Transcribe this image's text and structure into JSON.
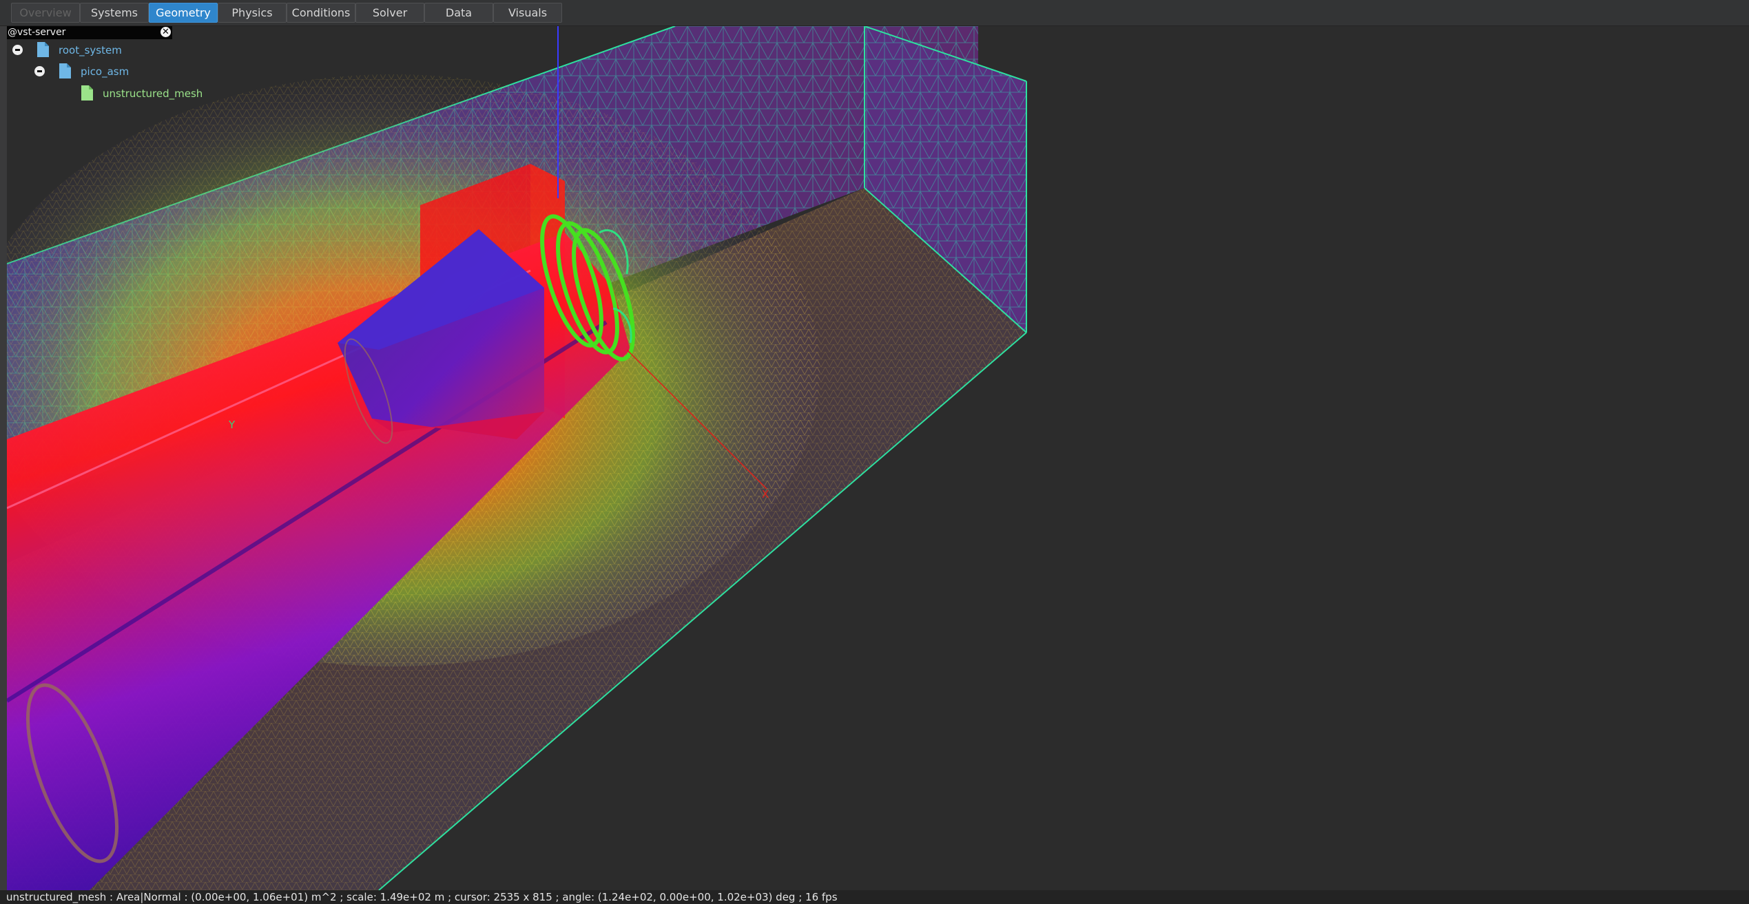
{
  "tabs": [
    {
      "label": "Overview",
      "state": "disabled"
    },
    {
      "label": "Systems",
      "state": "normal"
    },
    {
      "label": "Geometry",
      "state": "active"
    },
    {
      "label": "Physics",
      "state": "normal"
    },
    {
      "label": "Conditions",
      "state": "normal"
    },
    {
      "label": "Solver",
      "state": "normal"
    },
    {
      "label": "Data",
      "state": "normal"
    },
    {
      "label": "Visuals",
      "state": "normal"
    }
  ],
  "tree": {
    "server_label": "@vst-server",
    "close_icon": "close-icon",
    "nodes": [
      {
        "label": "root_system",
        "icon": "file-icon",
        "color": "#6fb7e6",
        "expanded": true
      },
      {
        "label": "pico_asm",
        "icon": "file-icon",
        "color": "#6fb7e6",
        "expanded": true
      },
      {
        "label": "unstructured_mesh",
        "icon": "file-icon",
        "color": "#9be38a",
        "expanded": false
      }
    ]
  },
  "viewport": {
    "axis_labels": {
      "y": "Y",
      "x": "X"
    },
    "colors": {
      "domain_mesh": "#2ee0a0",
      "body_red": "#ff0a1a",
      "body_blue": "#4b10c9",
      "rings": "#46e020",
      "x_axis": "#e0201a",
      "y_axis": "#3a3aff"
    }
  },
  "status": {
    "text": "unstructured_mesh : Area|Normal : (0.00e+00, 1.06e+01) m^2 ; scale: 1.49e+02 m ; cursor: 2535 x 815 ; angle: (1.24e+02, 0.00e+00, 1.02e+03) deg ; 16 fps"
  }
}
